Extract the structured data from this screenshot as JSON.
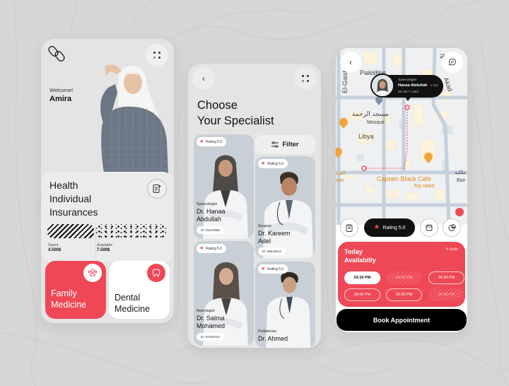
{
  "colors": {
    "accent": "#ee4856",
    "dark": "#111111",
    "background": "#d6d6d6",
    "card": "#e4e4e4",
    "map_orange": "#e08a1e"
  },
  "home_screen": {
    "logo": "capsule-logo-icon",
    "menu_icon": "grid-dots-icon",
    "welcome_text": "Welcome!",
    "user_name": "Amira",
    "insurance": {
      "title_lines": [
        "Health",
        "Individual",
        "Insurances"
      ],
      "icon": "document-add-icon",
      "spent_label": "Spent",
      "spent_value": "4.500$",
      "available_label": "Available",
      "available_value": "7.500$"
    },
    "categories": [
      {
        "label_line1": "Family",
        "label_line2": "Medicine",
        "icon": "family-group-icon",
        "active": true
      },
      {
        "label_line1": "Dental",
        "label_line2": "Medicine",
        "icon": "tooth-icon",
        "active": false
      }
    ]
  },
  "specialist_screen": {
    "back_icon": "chevron-left-icon",
    "menu_icon": "grid-dots-icon",
    "title_line1": "Choose",
    "title_line2": "Your Specialist",
    "filter_label": "Filter",
    "doctors": [
      {
        "rating": "Rating 5.0",
        "specialty": "Gynecologist",
        "name_line1": "Dr. Hanaa",
        "name_line2": "Abdullah",
        "id": "ID: 65420980"
      },
      {
        "rating": "Rating 5.0",
        "specialty": "Surgeon",
        "name_line1": "Dr. Kareem",
        "name_line2": "Adel",
        "id": "ID: 86546012"
      },
      {
        "rating": "Rating 5.0",
        "specialty": "Neurologist",
        "name_line1": "Dr. Salma",
        "name_line2": "Mohamed",
        "id": "ID: 97653423"
      },
      {
        "rating": "Rating 5.0",
        "specialty": "Pediatrician",
        "name_line1": "Dr. Ahmed",
        "name_line2": "",
        "id": ""
      }
    ]
  },
  "booking_screen": {
    "back_icon": "chevron-left-icon",
    "chat_icon": "chat-bubble-icon",
    "map_labels": {
      "palestine": "Palestine",
      "el_gaish": "El-Gaish",
      "el_akad": "El-Akad",
      "al": "Al",
      "akad": "Akad",
      "mosque_ar": "مسجد الرحمة",
      "mosque": "Mosque",
      "libya": "Libya",
      "cafe": "Captain Black Cafe",
      "cafe_sub": "Top rated",
      "restaurant_ar": "القبة",
      "restaurant": "rian",
      "bank_ar": "ملكية",
      "bank": "Ban"
    },
    "popup": {
      "specialty": "Gynecologist",
      "name": "Hanaa Abdullah",
      "rating": "5.0",
      "meta": "25 min  •  1.5ml"
    },
    "actions": {
      "rating_label": "Rating 5.0",
      "icons": [
        "clipboard-icon",
        "star-icon",
        "calendar-icon",
        "pie-chart-icon"
      ]
    },
    "availability": {
      "title_line1": "Today",
      "title_line2": "Availabilty",
      "stats": "4 Stats",
      "slots": [
        {
          "time": "03:30 PM",
          "state": "selected"
        },
        {
          "time": "04:00 PM",
          "state": "unavailable"
        },
        {
          "time": "04:30 PM",
          "state": "available"
        },
        {
          "time": "05:00 PM",
          "state": "available"
        },
        {
          "time": "05:30 PM",
          "state": "available"
        },
        {
          "time": "06:00 PM",
          "state": "unavailable"
        }
      ]
    },
    "book_label": "Book Appointment"
  }
}
